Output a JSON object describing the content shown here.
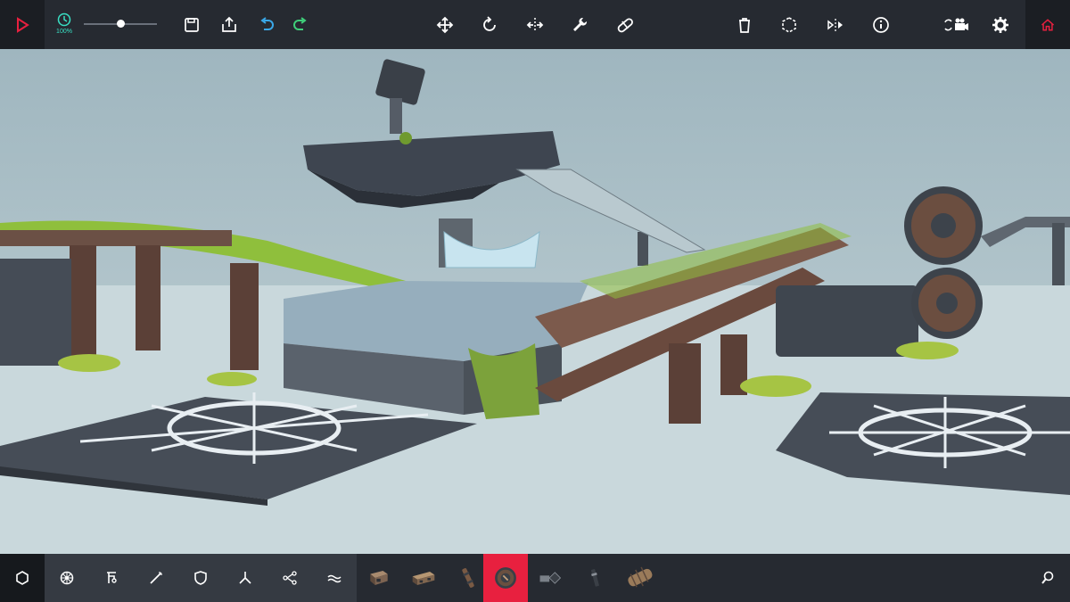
{
  "toolbar": {
    "play": {
      "icon": "play-icon"
    },
    "simulation_speed": {
      "label": "100%",
      "icon": "clock-icon",
      "level": 0.5
    },
    "file_actions": [
      {
        "name": "save-button",
        "icon": "save-icon"
      },
      {
        "name": "load-button",
        "icon": "load-icon"
      },
      {
        "name": "undo-button",
        "icon": "undo-icon"
      },
      {
        "name": "redo-button",
        "icon": "redo-icon"
      }
    ],
    "transform_tools": [
      {
        "name": "translate-tool",
        "icon": "move-arrows-icon"
      },
      {
        "name": "rotate-tool",
        "icon": "rotate-icon"
      },
      {
        "name": "flip-tool",
        "icon": "flip-icon"
      },
      {
        "name": "tweak-tool",
        "icon": "wrench-icon"
      },
      {
        "name": "stabilize-tool",
        "icon": "pill-icon"
      }
    ],
    "right_actions": [
      {
        "name": "delete-button",
        "icon": "trash-icon"
      },
      {
        "name": "select-mode-button",
        "icon": "hexagon-dashed-icon"
      },
      {
        "name": "mirror-button",
        "icon": "mirror-icon"
      },
      {
        "name": "info-button",
        "icon": "info-icon"
      },
      {
        "name": "camera-button",
        "icon": "camera-icon"
      },
      {
        "name": "settings-button",
        "icon": "gear-icon"
      },
      {
        "name": "home-button",
        "icon": "home-icon"
      }
    ]
  },
  "bottom_bar": {
    "selected_category": {
      "icon": "hexagon-icon"
    },
    "categories": [
      {
        "name": "category-locomotion",
        "icon": "wheel-icon"
      },
      {
        "name": "category-mechanical",
        "icon": "crane-icon"
      },
      {
        "name": "category-weaponry",
        "icon": "wand-icon"
      },
      {
        "name": "category-armour",
        "icon": "shield-icon"
      },
      {
        "name": "category-utility",
        "icon": "tri-joint-icon"
      },
      {
        "name": "category-automation",
        "icon": "logic-nodes-icon"
      },
      {
        "name": "category-flight",
        "icon": "waves-icon"
      }
    ],
    "parts": [
      {
        "name": "part-block-1",
        "icon": "block-icon"
      },
      {
        "name": "part-block-2",
        "icon": "long-block-icon"
      },
      {
        "name": "part-log",
        "icon": "log-icon"
      },
      {
        "name": "part-wheel",
        "icon": "wheel-part-icon",
        "selected": true
      },
      {
        "name": "part-hinge",
        "icon": "hinge-icon"
      },
      {
        "name": "part-pin",
        "icon": "pin-icon"
      },
      {
        "name": "part-cannon",
        "icon": "barrel-icon"
      }
    ],
    "search": {
      "icon": "search-icon"
    }
  },
  "colors": {
    "accent_red": "#e8203f",
    "accent_teal": "#39e0c4",
    "undo_blue": "#3aa8e8",
    "redo_green": "#3fd07a",
    "bar_bg": "#262a31",
    "sky": "#a9bcc4",
    "ground": "#c9d8dc"
  }
}
